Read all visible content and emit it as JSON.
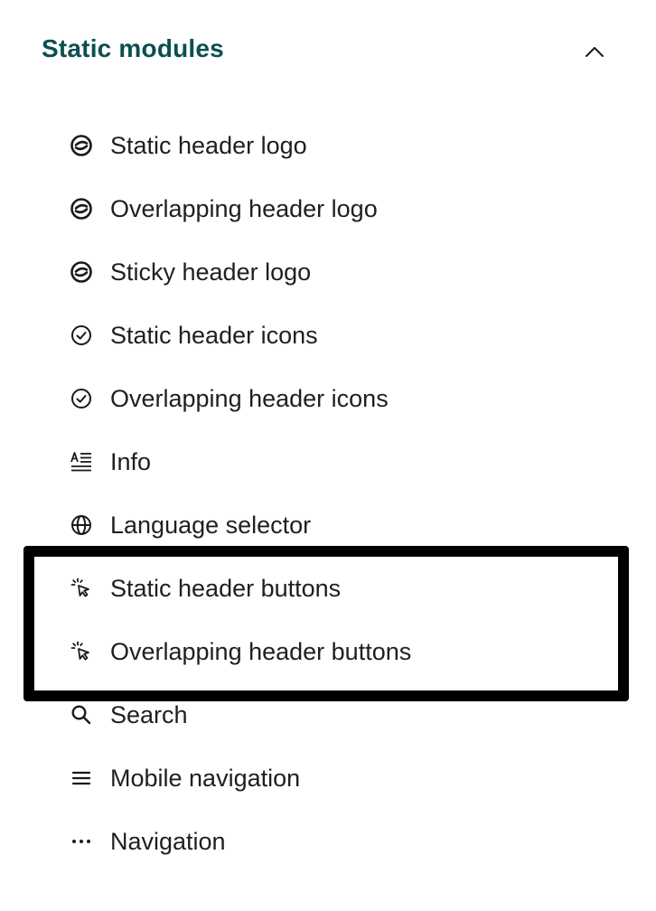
{
  "section": {
    "title": "Static modules",
    "chevron_icon": "chevron-up-icon",
    "expanded": true
  },
  "items": [
    {
      "label": "Static header logo",
      "icon": "logo-icon"
    },
    {
      "label": "Overlapping header logo",
      "icon": "logo-icon"
    },
    {
      "label": "Sticky header logo",
      "icon": "logo-icon"
    },
    {
      "label": "Static header icons",
      "icon": "check-circle-icon"
    },
    {
      "label": "Overlapping header icons",
      "icon": "check-circle-icon"
    },
    {
      "label": "Info",
      "icon": "text-format-icon"
    },
    {
      "label": "Language selector",
      "icon": "globe-icon"
    },
    {
      "label": "Static header buttons",
      "icon": "cursor-click-icon"
    },
    {
      "label": "Overlapping header buttons",
      "icon": "cursor-click-icon"
    },
    {
      "label": "Search",
      "icon": "search-icon"
    },
    {
      "label": "Mobile navigation",
      "icon": "menu-icon"
    },
    {
      "label": "Navigation",
      "icon": "more-horizontal-icon"
    }
  ],
  "colors": {
    "title": "#0b4f52",
    "text": "#1f1f1f",
    "highlight_border": "#000000"
  }
}
